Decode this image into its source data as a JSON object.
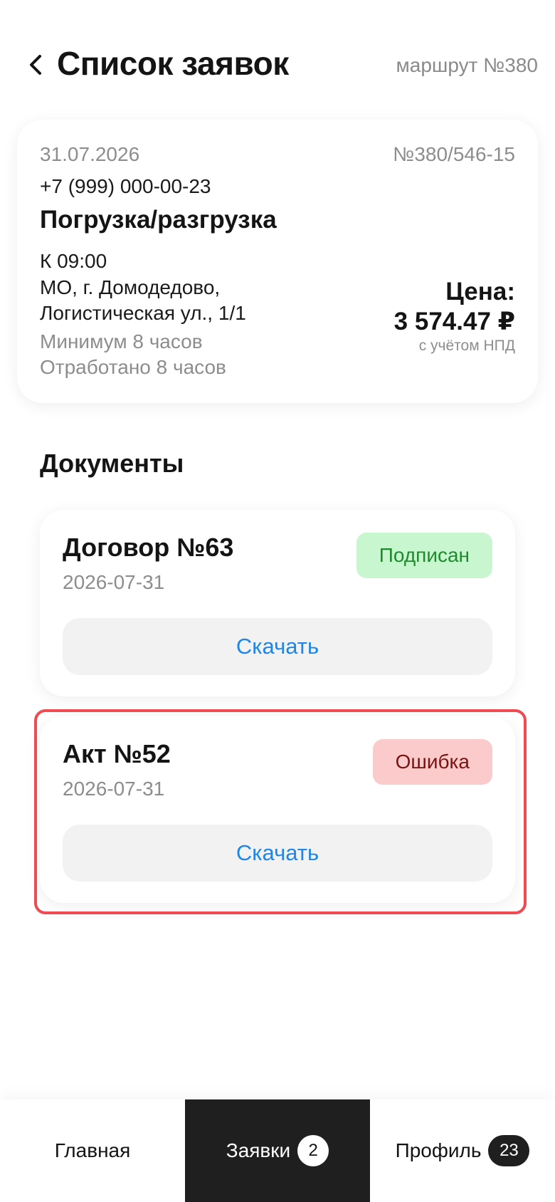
{
  "header": {
    "title": "Список заявок",
    "route": "маршрут №380"
  },
  "order": {
    "date": "31.07.2026",
    "number": "№380/546-15",
    "phone": "+7 (999) 000-00-23",
    "service": "Погрузка/разгрузка",
    "time": "К 09:00",
    "address": "МО, г. Домодедово, Логистическая ул., 1/1",
    "minimum": "Минимум 8 часов",
    "worked": "Отработано 8 часов",
    "price_label": "Цена:",
    "price_value": "3 574.47 ₽",
    "price_note": "с учётом НПД"
  },
  "documents": {
    "section_title": "Документы",
    "items": [
      {
        "title": "Договор №63",
        "date": "2026-07-31",
        "status": "Подписан",
        "download_label": "Скачать"
      },
      {
        "title": "Акт №52",
        "date": "2026-07-31",
        "status": "Ошибка",
        "download_label": "Скачать"
      }
    ]
  },
  "nav": {
    "items": [
      {
        "label": "Главная",
        "badge": ""
      },
      {
        "label": "Заявки",
        "badge": "2"
      },
      {
        "label": "Профиль",
        "badge": "23"
      }
    ]
  },
  "colors": {
    "status_signed_bg": "#c8f7cf",
    "status_signed_text": "#1f8a2e",
    "status_error_bg": "#fbcaca",
    "status_error_text": "#7a1212",
    "link_blue": "#1f86e8",
    "highlight": "#f04a52",
    "nav_active": "#1f1f1f"
  },
  "icons": {
    "back": "chevron-left-icon"
  }
}
